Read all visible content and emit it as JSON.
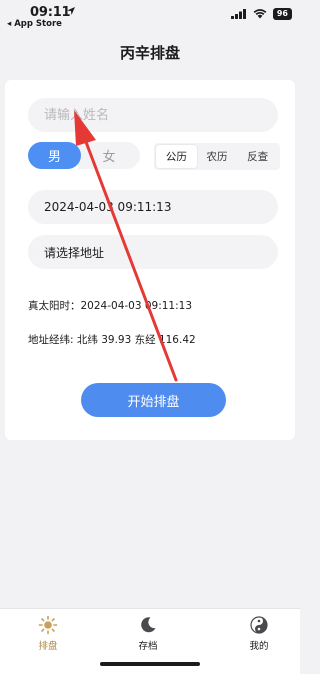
{
  "status_bar": {
    "time": "09:11",
    "back_app": "◂ App Store",
    "battery": "96"
  },
  "nav": {
    "title": "丙辛排盘"
  },
  "form": {
    "name_placeholder": "请输入姓名",
    "name_value": "",
    "gender": {
      "male": "男",
      "female": "女",
      "selected": "男"
    },
    "calendar": {
      "options": [
        "公历",
        "农历",
        "反查"
      ],
      "selected": "公历"
    },
    "datetime": "2024-04-03 09:11:13",
    "address": "请选择地址",
    "true_solar_time": "真太阳时：2024-04-03 09:11:13",
    "coordinates": "地址经纬: 北纬 39.93 东经 116.42",
    "start_button": "开始排盘"
  },
  "tabbar": {
    "items": [
      {
        "label": "排盘",
        "icon": "sun-icon",
        "active": true
      },
      {
        "label": "存档",
        "icon": "moon-icon",
        "active": false
      },
      {
        "label": "我的",
        "icon": "taiji-icon",
        "active": false
      }
    ]
  },
  "colors": {
    "accent": "#4f8cf0",
    "tab_active": "#b08a4a",
    "annotation_arrow": "#e53935"
  }
}
